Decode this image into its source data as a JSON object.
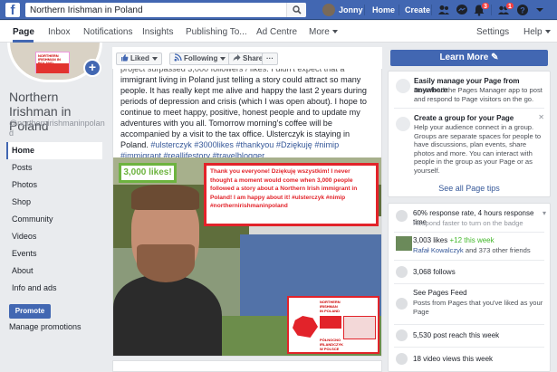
{
  "topbar": {
    "search_value": "Northern Irishman in Poland",
    "user_name": "Jonny",
    "home_label": "Home",
    "create_label": "Create",
    "notifications_count": "3",
    "requests_count": "1"
  },
  "pagebar": {
    "tabs": [
      "Page",
      "Inbox",
      "Notifications",
      "Insights",
      "Publishing To...",
      "Ad Centre",
      "More"
    ],
    "settings_label": "Settings",
    "help_label": "Help"
  },
  "left": {
    "page_name": "Northern Irishman in Poland",
    "handle": "@northernirishmaninpoland",
    "nav": [
      "Home",
      "Posts",
      "Photos",
      "Shop",
      "Community",
      "Videos",
      "Events",
      "About",
      "Info and ads"
    ],
    "promote_label": "Promote",
    "manage_label": "Manage promotions",
    "mini_logo_text": "NORTHERN IRISHMAN IN POLAND"
  },
  "post_toolbar": {
    "liked_label": "Liked",
    "following_label": "Following",
    "share_label": "Share",
    "more_label": "···"
  },
  "post": {
    "text_line0": "project surpassed 3,000 followers / likes. I didn't expect that a Northern Irish",
    "text_body": "immigrant living in Poland just telling a story could attract so many people. It has really kept me alive and happy the last 2 years during periods of depression and crisis (which I was open about). I hope to continue to meet happy, positive, honest people and to update my adventures with you all. Tomorrow morning's coffee will be accompanied by a visit to the tax office. Ulsterczyk is staying in Poland.",
    "tags": "#ulsterczyk #3000likes #thankyou #Dziękuję #nimip #immigrant #reallifestory #travelblogger",
    "likes_badge": "3,000 likes!",
    "thank_text": "Thank you everyone! Dziękuję wszystkim! I never thought a moment would come when 3,000 people followed a story about a Northern Irish immigrant in Poland! I am happy about it! #ulsterczyk #nimip #northernirishmaninpoland",
    "logo_text_top": "NORTHERN IRISHMAN IN POLAND",
    "logo_text_bottom": "PÓŁNOCNO IRLANDCZYK W POLSCE"
  },
  "right": {
    "learn_more_label": "Learn More",
    "tip1_title": "Easily manage your Page from anywhere",
    "tip1_body": "Download the Pages Manager app to post and respond to Page visitors on the go.",
    "tip2_title": "Create a group for your Page",
    "tip2_body": "Help your audience connect in a group. Groups are separate spaces for people to have discussions, plan events, share photos and more. You can interact with people in the group as your Page or as yourself.",
    "see_all_label": "See all Page tips",
    "response_rate": "60% response rate, 4 hours response time",
    "response_sub": "Respond faster to turn on the badge",
    "likes_main": "3,003 likes",
    "likes_week": "+12 this week",
    "likes_friend": "Rafał Kowalczyk",
    "likes_friend_rest": "and 373 other friends",
    "follows": "3,068 follows",
    "feed_title": "See Pages Feed",
    "feed_body": "Posts from Pages that you've liked as your Page",
    "reach": "5,530 post reach this week",
    "video_views": "18 video views this week"
  },
  "colors": {
    "brand_blue": "#4267b2",
    "green_accent": "#42b72a",
    "red_accent": "#e2232a"
  }
}
